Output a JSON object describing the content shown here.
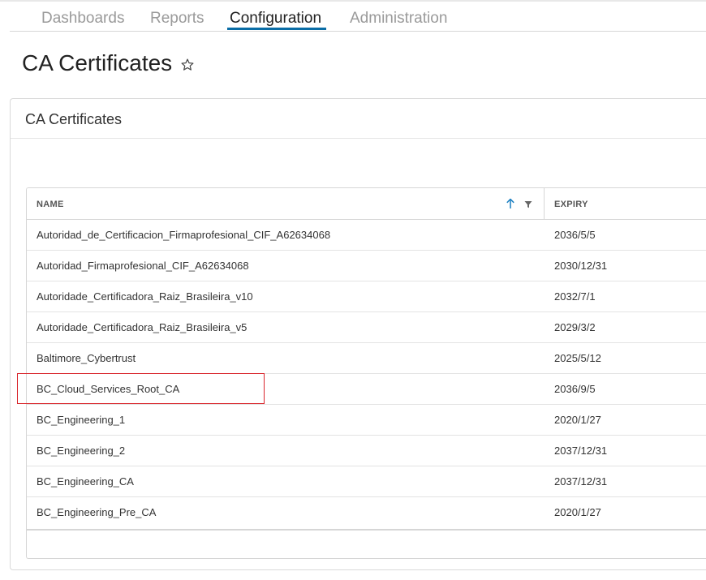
{
  "nav": {
    "tabs": [
      {
        "label": "Dashboards",
        "active": false
      },
      {
        "label": "Reports",
        "active": false
      },
      {
        "label": "Configuration",
        "active": true
      },
      {
        "label": "Administration",
        "active": false
      }
    ]
  },
  "page": {
    "title": "CA Certificates",
    "favorite_icon": "star-outline-icon"
  },
  "panel": {
    "title": "CA Certificates"
  },
  "table": {
    "columns": [
      {
        "label": "NAME",
        "sort": "ascending",
        "filterable": true
      },
      {
        "label": "EXPIRY"
      }
    ],
    "rows": [
      {
        "name": "Autoridad_de_Certificacion_Firmaprofesional_CIF_A62634068",
        "expiry": "2036/5/5"
      },
      {
        "name": "Autoridad_Firmaprofesional_CIF_A62634068",
        "expiry": "2030/12/31"
      },
      {
        "name": "Autoridade_Certificadora_Raiz_Brasileira_v10",
        "expiry": "2032/7/1"
      },
      {
        "name": "Autoridade_Certificadora_Raiz_Brasileira_v5",
        "expiry": "2029/3/2"
      },
      {
        "name": "Baltimore_Cybertrust",
        "expiry": "2025/5/12"
      },
      {
        "name": "BC_Cloud_Services_Root_CA",
        "expiry": "2036/9/5",
        "highlighted": true
      },
      {
        "name": "BC_Engineering_1",
        "expiry": "2020/1/27"
      },
      {
        "name": "BC_Engineering_2",
        "expiry": "2037/12/31"
      },
      {
        "name": "BC_Engineering_CA",
        "expiry": "2037/12/31"
      },
      {
        "name": "BC_Engineering_Pre_CA",
        "expiry": "2020/1/27"
      }
    ]
  },
  "colors": {
    "accent": "#0a6da6",
    "highlight": "#d9252b"
  }
}
